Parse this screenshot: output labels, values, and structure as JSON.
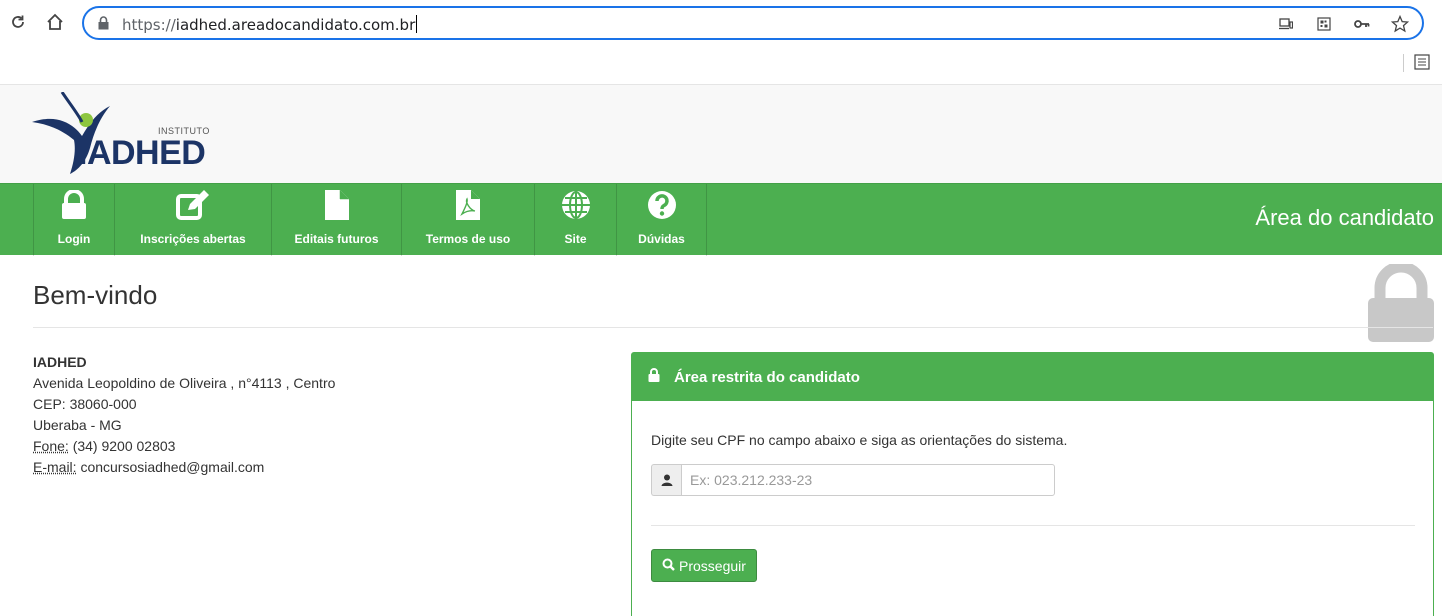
{
  "browser": {
    "url_scheme": "https://",
    "url_host": "iadhed.areadocandidato.com.br"
  },
  "logo": {
    "small_text": "INSTITUTO",
    "big_text": "IADHED"
  },
  "nav": {
    "items": [
      {
        "label": "Login",
        "icon": "lock-icon"
      },
      {
        "label": "Inscrições abertas",
        "icon": "edit-icon"
      },
      {
        "label": "Editais futuros",
        "icon": "file-icon"
      },
      {
        "label": "Termos de uso",
        "icon": "pdf-icon"
      },
      {
        "label": "Site",
        "icon": "globe-icon"
      },
      {
        "label": "Dúvidas",
        "icon": "question-icon"
      }
    ],
    "title": "Área do candidato"
  },
  "colors": {
    "brand_green": "#4caf50",
    "logo_navy": "#1c3466"
  },
  "main": {
    "heading": "Bem-vindo"
  },
  "address": {
    "name": "IADHED",
    "street": "Avenida Leopoldino de Oliveira , n°4113 , Centro",
    "cep": "CEP: 38060-000",
    "city": "Uberaba - MG",
    "phone_label": "Fone:",
    "phone": " (34) 9200 02803",
    "email_label": "E-mail:",
    "email": " concursosiadhed@gmail.com"
  },
  "panel": {
    "title": "Área restrita do candidato",
    "instruction": "Digite seu CPF no campo abaixo e siga as orientações do sistema.",
    "cpf_placeholder": "Ex: 023.212.233-23",
    "cpf_value": "",
    "submit_label": "Prosseguir"
  }
}
